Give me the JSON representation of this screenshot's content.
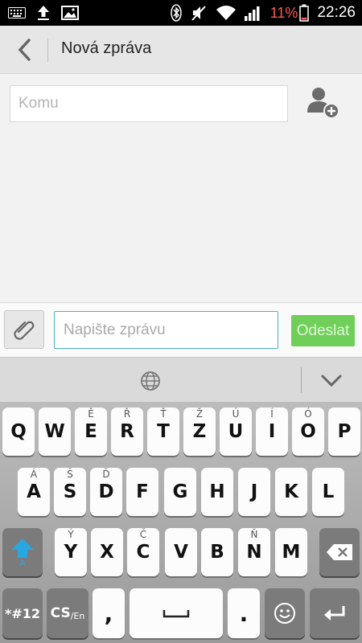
{
  "status_bar": {
    "battery_percent": "11%",
    "time": "22:26",
    "left_icons": [
      "keyboard-icon",
      "upload-icon",
      "image-icon"
    ],
    "right_icons": [
      "bluetooth-icon",
      "mute-icon",
      "wifi-icon",
      "signal-icon",
      "battery-icon"
    ]
  },
  "header": {
    "title": "Nová zpráva",
    "back_icon": "chevron-left-icon"
  },
  "recipient": {
    "placeholder": "Komu",
    "value": "",
    "add_contact_icon": "add-contact-icon"
  },
  "compose": {
    "attach_icon": "paperclip-icon",
    "placeholder": "Napište zprávu",
    "value": "",
    "send_label": "Odeslat",
    "send_color": "#6fcf59"
  },
  "keyboard": {
    "toolbar_icons": [
      "globe-icon",
      "chevron-down-icon"
    ],
    "rows": [
      [
        {
          "label": "Q",
          "sec": ""
        },
        {
          "label": "W",
          "sec": ""
        },
        {
          "label": "E",
          "sec": "Ě"
        },
        {
          "label": "R",
          "sec": "Ř"
        },
        {
          "label": "T",
          "sec": "Ť"
        },
        {
          "label": "Z",
          "sec": "Ž"
        },
        {
          "label": "U",
          "sec": "Ú"
        },
        {
          "label": "I",
          "sec": "Í"
        },
        {
          "label": "O",
          "sec": "Ó"
        },
        {
          "label": "P",
          "sec": ""
        }
      ],
      [
        {
          "label": "A",
          "sec": "Á"
        },
        {
          "label": "S",
          "sec": "Š"
        },
        {
          "label": "D",
          "sec": "Ď"
        },
        {
          "label": "F",
          "sec": ""
        },
        {
          "label": "G",
          "sec": ""
        },
        {
          "label": "H",
          "sec": ""
        },
        {
          "label": "J",
          "sec": ""
        },
        {
          "label": "K",
          "sec": ""
        },
        {
          "label": "L",
          "sec": ""
        }
      ],
      [
        {
          "label": "Y",
          "sec": "Ý"
        },
        {
          "label": "X",
          "sec": ""
        },
        {
          "label": "C",
          "sec": "Č"
        },
        {
          "label": "V",
          "sec": ""
        },
        {
          "label": "B",
          "sec": ""
        },
        {
          "label": "N",
          "sec": "Ň"
        },
        {
          "label": "M",
          "sec": ""
        }
      ]
    ],
    "shift_sub": "A",
    "symbols_label": "*#12",
    "lang_main": "CS",
    "lang_sub": "/En",
    "comma": ",",
    "period": ".",
    "accent_color": "#2aa6e0"
  }
}
